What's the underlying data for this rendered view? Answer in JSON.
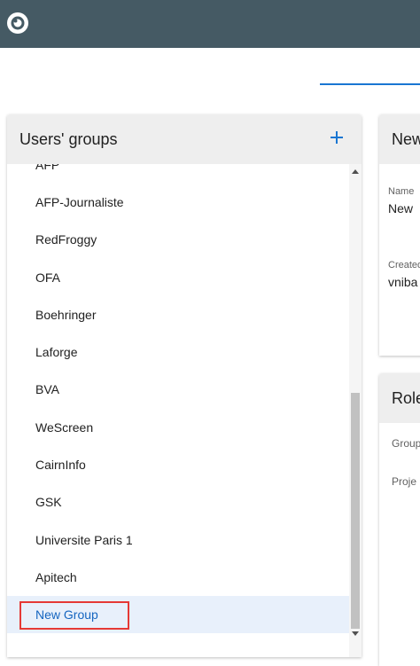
{
  "header": {
    "logo_icon": "eye-logo-icon",
    "bg_color": "#455a64"
  },
  "groups_panel": {
    "title": "Users' groups",
    "add_icon": "plus-icon",
    "items": [
      "AFP",
      "AFP-Journaliste",
      "RedFroggy",
      "OFA",
      "Boehringer",
      "Laforge",
      "BVA",
      "WeScreen",
      "CairnInfo",
      "GSK",
      "Universite Paris 1",
      "Apitech",
      "New Group"
    ],
    "selected": "New Group"
  },
  "details_panel": {
    "title": "New",
    "name_label": "Name",
    "name_value": "New",
    "created_label": "Created",
    "created_value": "vniba"
  },
  "roles_panel": {
    "title": "Role",
    "row1": "Group",
    "row2": "Proje"
  },
  "colors": {
    "accent": "#1976d2",
    "selected_bg": "#e8f0fb",
    "highlight_border": "#e53935"
  }
}
